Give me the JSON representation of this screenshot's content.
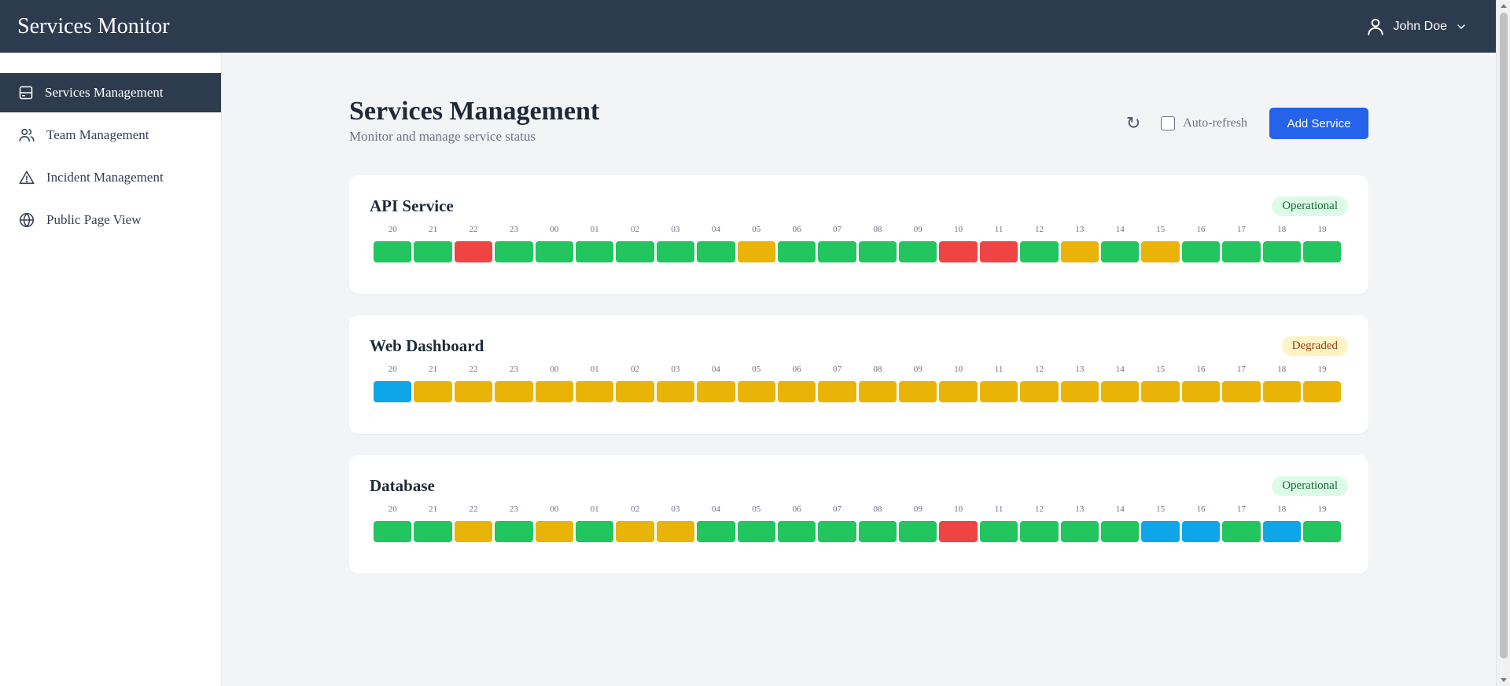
{
  "header": {
    "app_title": "Services Monitor",
    "user_name": "John Doe",
    "user_icon": "user-icon",
    "dropdown_icon": "chevron-down-icon"
  },
  "sidebar": {
    "items": [
      {
        "label": "Services Management",
        "icon": "server-icon",
        "active": true
      },
      {
        "label": "Team Management",
        "icon": "users-icon",
        "active": false
      },
      {
        "label": "Incident Management",
        "icon": "warning-icon",
        "active": false
      },
      {
        "label": "Public Page View",
        "icon": "globe-icon",
        "active": false
      }
    ]
  },
  "page": {
    "title": "Services Management",
    "subtitle": "Monitor and manage service status",
    "refresh_glyph": "↻",
    "auto_refresh_label": "Auto-refresh",
    "auto_refresh_checked": false,
    "add_button_label": "Add Service"
  },
  "hours": [
    "20",
    "21",
    "22",
    "23",
    "00",
    "01",
    "02",
    "03",
    "04",
    "05",
    "06",
    "07",
    "08",
    "09",
    "10",
    "11",
    "12",
    "13",
    "14",
    "15",
    "16",
    "17",
    "18",
    "19"
  ],
  "status_colors": {
    "up": "#22c55e",
    "down": "#ef4444",
    "warn": "#eab308",
    "maint": "#0ea5e9"
  },
  "services": [
    {
      "name": "API Service",
      "status": "Operational",
      "status_key": "operational",
      "history": [
        "up",
        "up",
        "down",
        "up",
        "up",
        "up",
        "up",
        "up",
        "up",
        "warn",
        "up",
        "up",
        "up",
        "up",
        "down",
        "down",
        "up",
        "warn",
        "up",
        "warn",
        "up",
        "up",
        "up",
        "up"
      ]
    },
    {
      "name": "Web Dashboard",
      "status": "Degraded",
      "status_key": "degraded",
      "history": [
        "maint",
        "warn",
        "warn",
        "warn",
        "warn",
        "warn",
        "warn",
        "warn",
        "warn",
        "warn",
        "warn",
        "warn",
        "warn",
        "warn",
        "warn",
        "warn",
        "warn",
        "warn",
        "warn",
        "warn",
        "warn",
        "warn",
        "warn",
        "warn"
      ]
    },
    {
      "name": "Database",
      "status": "Operational",
      "status_key": "operational",
      "history": [
        "up",
        "up",
        "warn",
        "up",
        "warn",
        "up",
        "warn",
        "warn",
        "up",
        "up",
        "up",
        "up",
        "up",
        "up",
        "down",
        "up",
        "up",
        "up",
        "up",
        "maint",
        "maint",
        "up",
        "maint",
        "up"
      ]
    }
  ]
}
